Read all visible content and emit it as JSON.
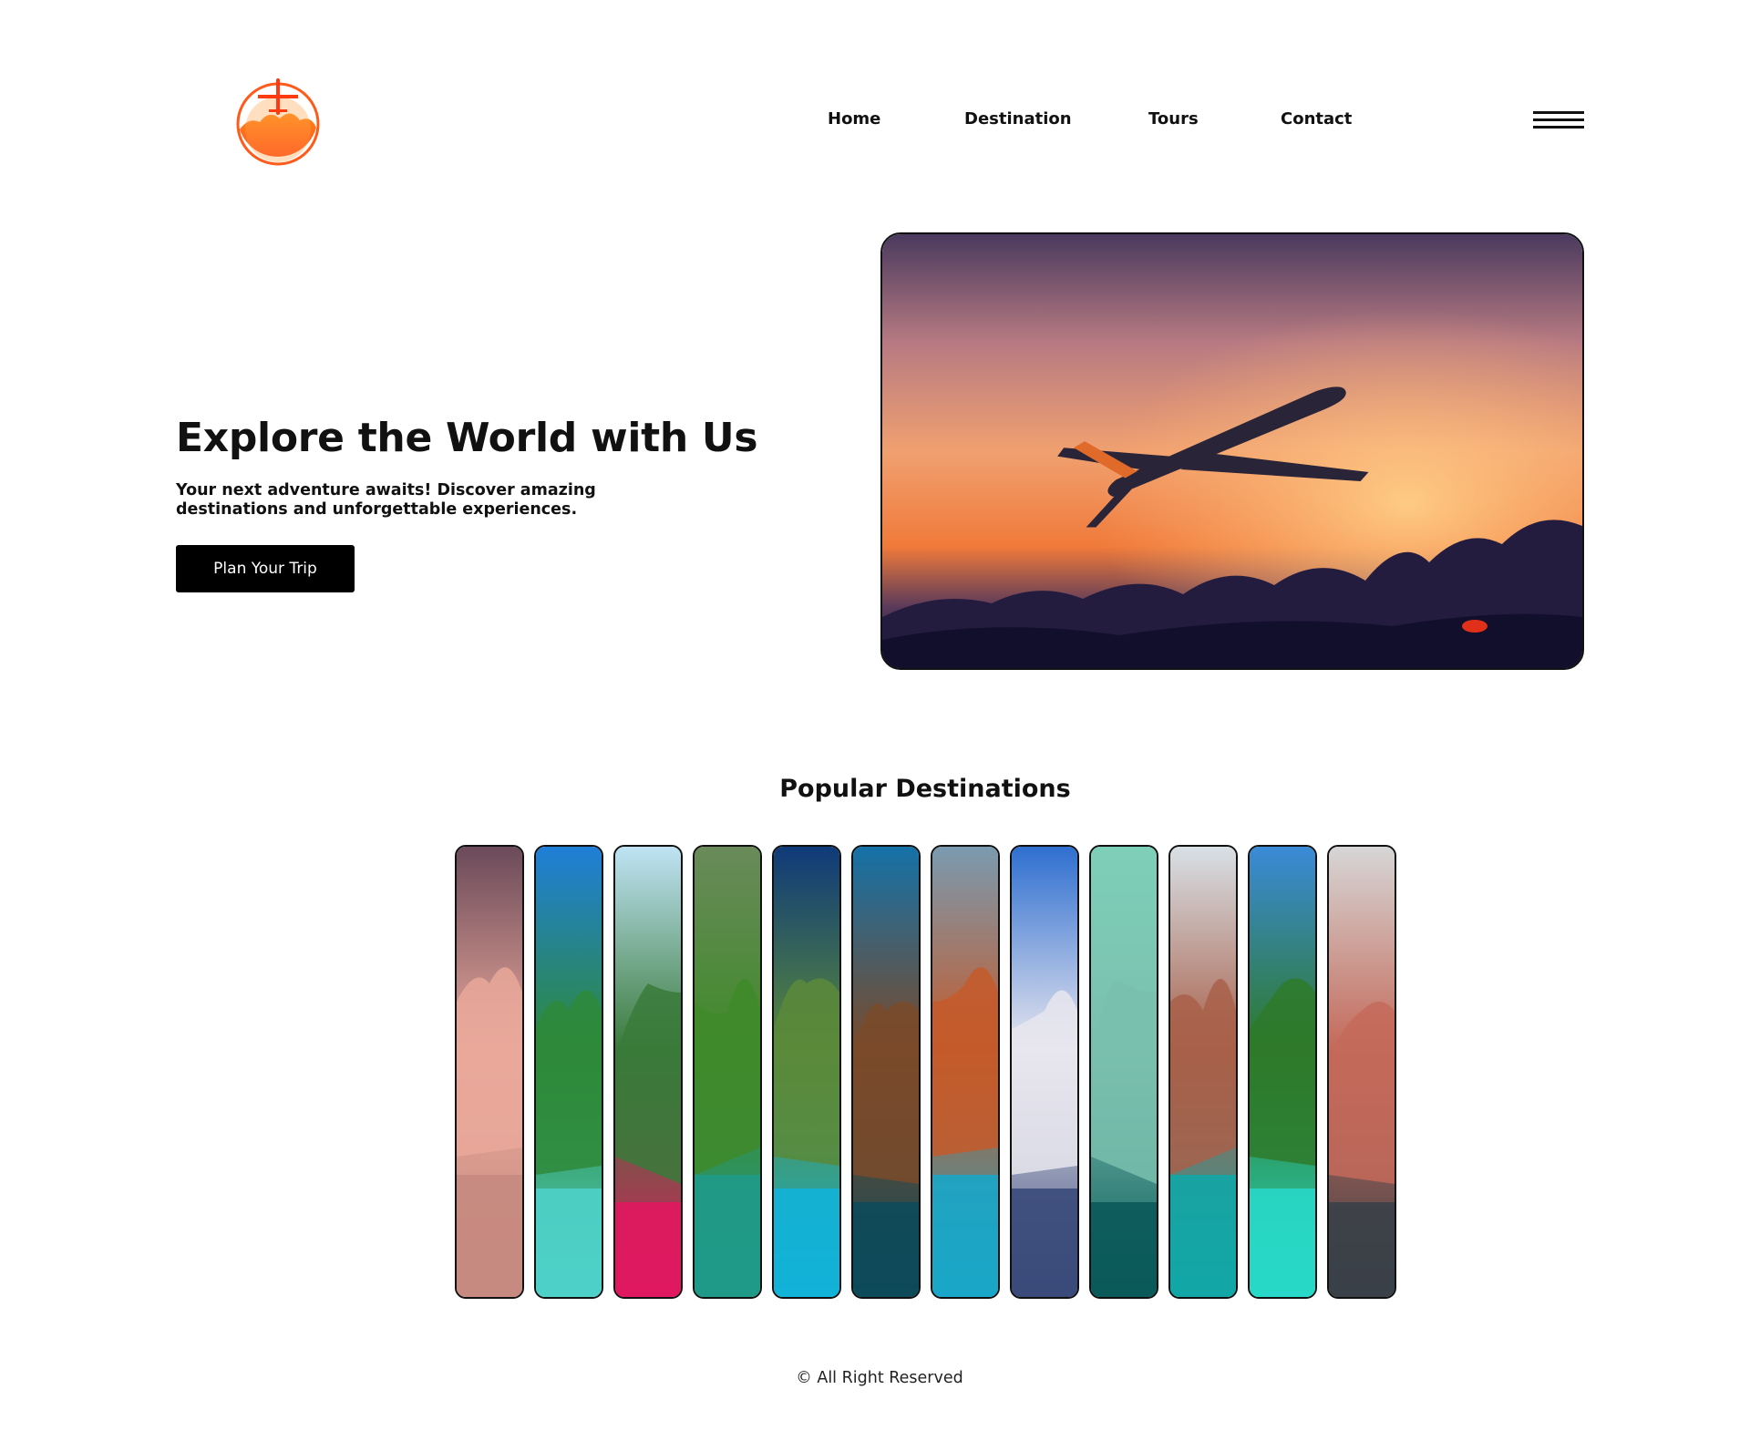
{
  "header": {
    "logo_icon": "airplane-sunset-logo",
    "nav": [
      "Home",
      "Destination",
      "Tours",
      "Contact"
    ],
    "menu_icon": "hamburger-menu-icon"
  },
  "hero": {
    "title": "Explore the World with Us",
    "subtitle": "Your next adventure awaits! Discover amazing destinations and unforgettable experiences.",
    "cta_label": "Plan Your Trip",
    "image": "airplane-flying-at-sunset"
  },
  "destinations": {
    "title": "Popular Destinations",
    "items": [
      {
        "image": "sunset-pier",
        "sky": "#6b4a5a",
        "mid": "#e9a89a",
        "low": "#c68a80"
      },
      {
        "image": "tropical-cliffs",
        "sky": "#1f7fd8",
        "mid": "#2e8a3a",
        "low": "#4ed0c8"
      },
      {
        "image": "kayak-lagoon",
        "sky": "#bfe3f4",
        "mid": "#3a7a3a",
        "low": "#e0185f"
      },
      {
        "image": "green-mountain-bay",
        "sky": "#6a8a5a",
        "mid": "#3f8a2a",
        "low": "#1f9a8a"
      },
      {
        "image": "overwater-bungalows",
        "sky": "#0f3a7a",
        "mid": "#5a8a3a",
        "low": "#12b3d8"
      },
      {
        "image": "lakeside-town-night",
        "sky": "#1572a8",
        "mid": "#7a4a2a",
        "low": "#0d4a5a"
      },
      {
        "image": "colorful-coastal-village",
        "sky": "#7a9ab0",
        "mid": "#c45a2a",
        "low": "#1aa6c8"
      },
      {
        "image": "santorini",
        "sky": "#2f6fd0",
        "mid": "#e8e6ef",
        "low": "#3a4a7a"
      },
      {
        "image": "infinity-pool-sea",
        "sky": "#7ecfb8",
        "mid": "#7abfae",
        "low": "#0b5a5a"
      },
      {
        "image": "tropical-resort",
        "sky": "#d8e0e6",
        "mid": "#a8604a",
        "low": "#12a6a6"
      },
      {
        "image": "island-beach",
        "sky": "#3a8ad8",
        "mid": "#2e7a2a",
        "low": "#28d8c8"
      },
      {
        "image": "cliffside-village",
        "sky": "#d6d6d6",
        "mid": "#c46a5a",
        "low": "#3a4048"
      }
    ]
  },
  "footer": {
    "text": "© All Right Reserved"
  }
}
